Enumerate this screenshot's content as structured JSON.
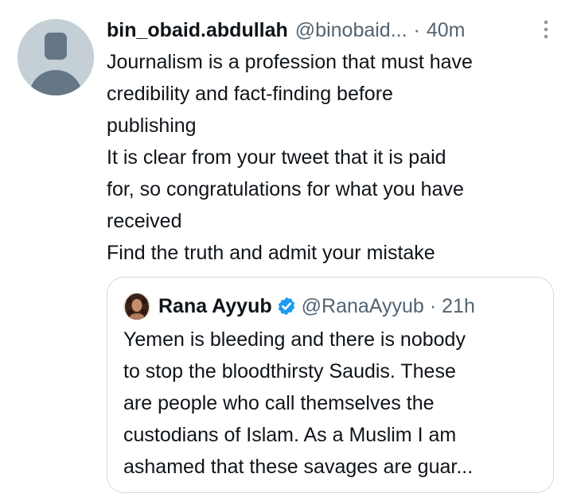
{
  "reply": {
    "display_name": "bin_obaid.abdullah",
    "handle": "@binobaid...",
    "separator": "·",
    "time": "40m",
    "more_icon": "vertical-ellipsis-icon",
    "lines": [
      "Journalism is a profession that must have",
      "credibility and fact-finding before",
      "publishing",
      "It is clear from your tweet that it is paid",
      "for, so congratulations for what you have",
      "received",
      "Find the truth and admit your mistake"
    ]
  },
  "quoted": {
    "display_name": "Rana Ayyub",
    "verified_icon": "verified-badge-icon",
    "handle": "@RanaAyyub",
    "separator": "·",
    "time": "21h",
    "lines": [
      "Yemen is bleeding and there is nobody",
      "to stop the bloodthirsty Saudis. These",
      "are people who call themselves the",
      "custodians of Islam. As a Muslim I am",
      "ashamed that these savages are guar..."
    ]
  },
  "colors": {
    "text": "#0f1419",
    "secondary": "#536471",
    "border": "#cfd9de",
    "verified": "#1d9bf0",
    "default_avatar_bg": "#c4cfd6"
  }
}
